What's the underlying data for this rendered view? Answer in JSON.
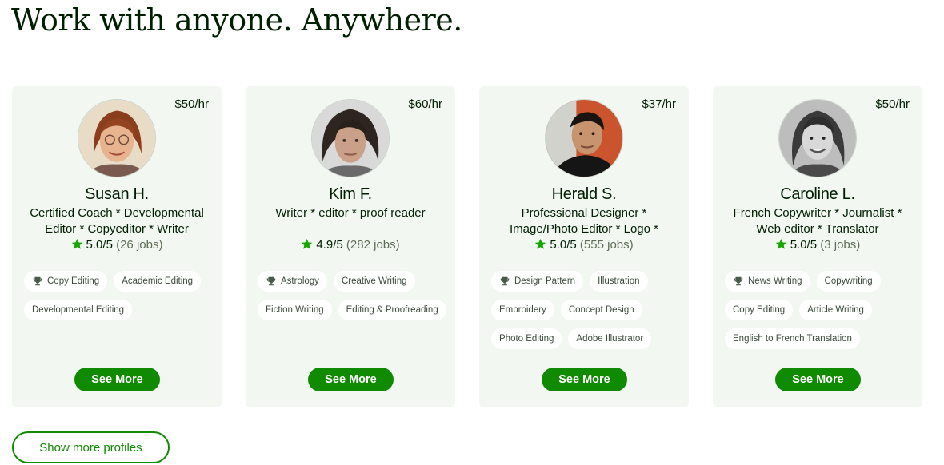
{
  "headline": "Work with anyone. Anywhere.",
  "colors": {
    "card_bg": "#f2f7f2",
    "brand_green": "#108a00",
    "star_green": "#14a800",
    "text_dark": "#001e00",
    "text_muted": "#5e6d55"
  },
  "profiles": [
    {
      "rate": "$50/hr",
      "avatar_icon": "avatar-photo",
      "name": "Susan H.",
      "title": "Certified Coach * Developmental Editor * Copyeditor * Writer",
      "rating": "5.0/5",
      "jobs": "(26 jobs)",
      "skills": [
        "Copy Editing",
        "Academic Editing",
        "Developmental Editing"
      ],
      "button": "See More"
    },
    {
      "rate": "$60/hr",
      "avatar_icon": "avatar-photo",
      "name": "Kim F.",
      "title": "Writer * editor * proof reader",
      "rating": "4.9/5",
      "jobs": "(282 jobs)",
      "skills": [
        "Astrology",
        "Creative Writing",
        "Fiction Writing",
        "Editing & Proofreading"
      ],
      "button": "See More"
    },
    {
      "rate": "$37/hr",
      "avatar_icon": "avatar-photo",
      "name": "Herald S.",
      "title": "Professional Designer * Image/Photo Editor * Logo *",
      "rating": "5.0/5",
      "jobs": "(555 jobs)",
      "skills": [
        "Design Pattern",
        "Illustration",
        "Embroidery",
        "Concept Design",
        "Photo Editing",
        "Adobe Illustrator"
      ],
      "button": "See More"
    },
    {
      "rate": "$50/hr",
      "avatar_icon": "avatar-photo",
      "name": "Caroline L.",
      "title": "French Copywriter * Journalist * Web editor * Translator",
      "rating": "5.0/5",
      "jobs": "(3 jobs)",
      "skills": [
        "News Writing",
        "Copywriting",
        "Copy Editing",
        "Article Writing",
        "English to French Translation"
      ],
      "button": "See More"
    }
  ],
  "show_more_label": "Show more profiles",
  "icons": {
    "rating": "star-icon",
    "top_skill": "trophy-icon"
  }
}
